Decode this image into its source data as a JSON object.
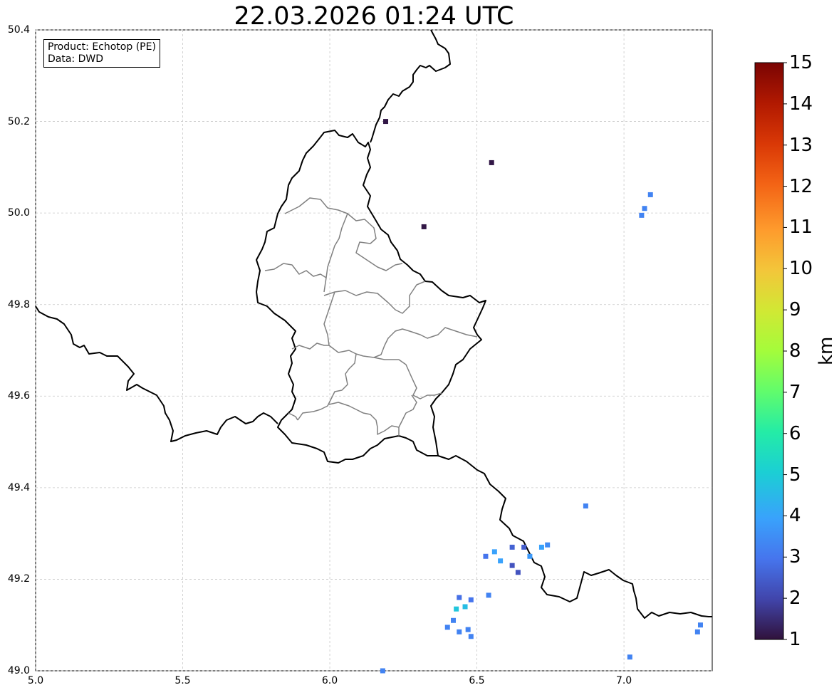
{
  "title": "22.03.2026 01:24 UTC",
  "info": {
    "product": "Product: Echotop (PE)",
    "data_source": "Data: DWD"
  },
  "axes": {
    "lon_range": [
      5.0,
      7.3
    ],
    "lat_range": [
      49.0,
      50.4
    ],
    "x_ticks": [
      5.0,
      5.5,
      6.0,
      6.5,
      7.0
    ],
    "x_tick_labels": [
      "5.0",
      "5.5",
      "6.0",
      "6.5",
      "7.0"
    ],
    "y_ticks": [
      49.0,
      49.2,
      49.4,
      49.6,
      49.8,
      50.0,
      50.2,
      50.4
    ],
    "y_tick_labels": [
      "49.0",
      "49.2",
      "49.4",
      "49.6",
      "49.8",
      "50.0",
      "50.2",
      "50.4"
    ],
    "grid": true
  },
  "colorbar": {
    "label": "km",
    "min": 1,
    "max": 15,
    "tick_labels": [
      "1",
      "2",
      "3",
      "4",
      "5",
      "6",
      "7",
      "8",
      "9",
      "10",
      "11",
      "12",
      "13",
      "14",
      "15"
    ],
    "colormap": "turbo"
  },
  "echo_cells": [
    {
      "lon": 6.19,
      "lat": 50.2,
      "km": 1.1
    },
    {
      "lon": 6.55,
      "lat": 50.11,
      "km": 1.1
    },
    {
      "lon": 6.32,
      "lat": 49.97,
      "km": 1.1
    },
    {
      "lon": 7.09,
      "lat": 50.04,
      "km": 3.3
    },
    {
      "lon": 7.07,
      "lat": 50.01,
      "km": 3.3
    },
    {
      "lon": 7.06,
      "lat": 49.995,
      "km": 3.3
    },
    {
      "lon": 6.87,
      "lat": 49.36,
      "km": 3.3
    },
    {
      "lon": 6.53,
      "lat": 49.25,
      "km": 3.0
    },
    {
      "lon": 6.56,
      "lat": 49.26,
      "km": 4.0
    },
    {
      "lon": 6.58,
      "lat": 49.24,
      "km": 4.0
    },
    {
      "lon": 6.62,
      "lat": 49.27,
      "km": 2.6
    },
    {
      "lon": 6.66,
      "lat": 49.27,
      "km": 2.5
    },
    {
      "lon": 6.68,
      "lat": 49.25,
      "km": 3.8
    },
    {
      "lon": 6.72,
      "lat": 49.27,
      "km": 4.0
    },
    {
      "lon": 6.74,
      "lat": 49.275,
      "km": 3.5
    },
    {
      "lon": 6.62,
      "lat": 49.23,
      "km": 2.3
    },
    {
      "lon": 6.64,
      "lat": 49.215,
      "km": 2.3
    },
    {
      "lon": 6.44,
      "lat": 49.16,
      "km": 2.9
    },
    {
      "lon": 6.48,
      "lat": 49.155,
      "km": 3.0
    },
    {
      "lon": 6.54,
      "lat": 49.165,
      "km": 3.3
    },
    {
      "lon": 6.46,
      "lat": 49.14,
      "km": 4.6
    },
    {
      "lon": 6.43,
      "lat": 49.135,
      "km": 4.8
    },
    {
      "lon": 6.42,
      "lat": 49.11,
      "km": 3.3
    },
    {
      "lon": 6.4,
      "lat": 49.095,
      "km": 3.3
    },
    {
      "lon": 6.44,
      "lat": 49.085,
      "km": 3.3
    },
    {
      "lon": 6.47,
      "lat": 49.09,
      "km": 3.3
    },
    {
      "lon": 6.48,
      "lat": 49.075,
      "km": 3.3
    },
    {
      "lon": 7.02,
      "lat": 49.03,
      "km": 3.3
    },
    {
      "lon": 7.26,
      "lat": 49.1,
      "km": 3.3
    },
    {
      "lon": 7.25,
      "lat": 49.085,
      "km": 3.3
    },
    {
      "lon": 6.18,
      "lat": 49.0,
      "km": 3.3
    }
  ]
}
